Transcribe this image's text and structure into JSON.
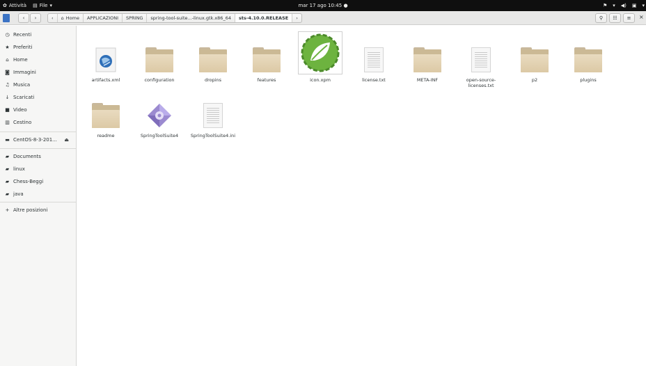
{
  "topbar": {
    "activities": "Attività",
    "app_menu": "File",
    "clock": "mar 17 ago 10:45"
  },
  "header": {
    "breadcrumbs": [
      {
        "label": "Home"
      },
      {
        "label": "APPLICAZIONI"
      },
      {
        "label": "SPRING"
      },
      {
        "label": "spring-tool-suite...-linux.gtk.x86_64"
      },
      {
        "label": "sts-4.10.0.RELEASE"
      }
    ]
  },
  "sidebar": {
    "places": [
      {
        "label": "Recenti",
        "icon": "clock-icon"
      },
      {
        "label": "Preferiti",
        "icon": "star-icon"
      },
      {
        "label": "Home",
        "icon": "home-icon"
      },
      {
        "label": "Immagini",
        "icon": "camera-icon"
      },
      {
        "label": "Musica",
        "icon": "music-icon"
      },
      {
        "label": "Scaricati",
        "icon": "download-icon"
      },
      {
        "label": "Video",
        "icon": "video-icon"
      },
      {
        "label": "Cestino",
        "icon": "trash-icon"
      }
    ],
    "devices": [
      {
        "label": "CentOS-8-3-201...",
        "icon": "drive-icon"
      }
    ],
    "bookmarks": [
      {
        "label": "Documents",
        "icon": "folder-icon"
      },
      {
        "label": "linux",
        "icon": "folder-icon"
      },
      {
        "label": "Chess-Beggi",
        "icon": "folder-icon"
      },
      {
        "label": "java",
        "icon": "folder-icon"
      }
    ],
    "other": {
      "label": "Altre posizioni",
      "icon": "plus-icon"
    }
  },
  "files": [
    {
      "name": "artifacts.xml",
      "type": "xml"
    },
    {
      "name": "configuration",
      "type": "folder"
    },
    {
      "name": "dropins",
      "type": "folder"
    },
    {
      "name": "features",
      "type": "folder"
    },
    {
      "name": "icon.xpm",
      "type": "image"
    },
    {
      "name": "license.txt",
      "type": "text"
    },
    {
      "name": "META-INF",
      "type": "folder"
    },
    {
      "name": "open-source-licenses.txt",
      "type": "text"
    },
    {
      "name": "p2",
      "type": "folder"
    },
    {
      "name": "plugins",
      "type": "folder"
    },
    {
      "name": "readme",
      "type": "folder"
    },
    {
      "name": "SpringToolSuite4",
      "type": "executable"
    },
    {
      "name": "SpringToolSuite4.ini",
      "type": "text"
    }
  ],
  "colors": {
    "topbar": "#0f0f0f",
    "folder": "#dcc9a5",
    "spring_green": "#6db33f"
  }
}
